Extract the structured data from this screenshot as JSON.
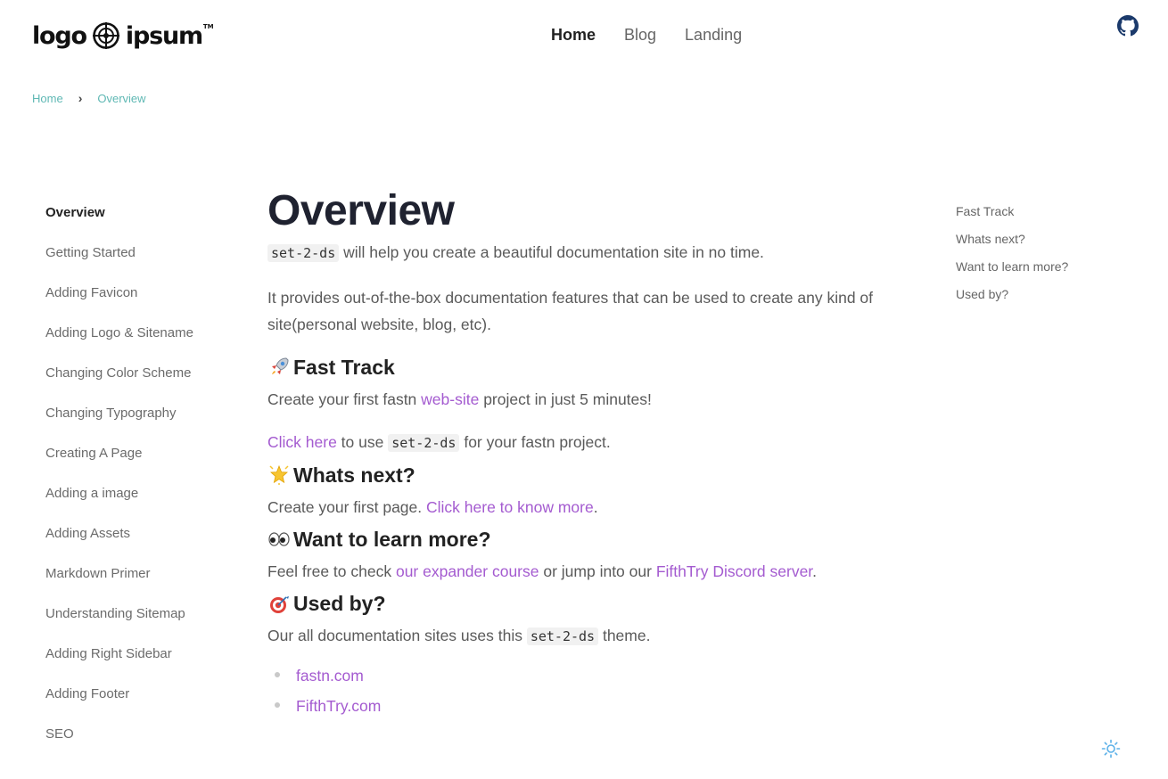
{
  "header": {
    "logo_word1": "logo",
    "logo_word2": "ipsum",
    "logo_tm": "TM",
    "nav": [
      {
        "label": "Home",
        "active": true
      },
      {
        "label": "Blog",
        "active": false
      },
      {
        "label": "Landing",
        "active": false
      }
    ],
    "github_icon": "github-icon"
  },
  "breadcrumb": {
    "home": "Home",
    "separator": "›",
    "current": "Overview"
  },
  "sidebar": {
    "items": [
      {
        "label": "Overview",
        "active": true
      },
      {
        "label": "Getting Started"
      },
      {
        "label": "Adding Favicon"
      },
      {
        "label": "Adding Logo & Sitename"
      },
      {
        "label": "Changing Color Scheme"
      },
      {
        "label": "Changing Typography"
      },
      {
        "label": "Creating A Page"
      },
      {
        "label": "Adding a image"
      },
      {
        "label": "Adding Assets"
      },
      {
        "label": "Markdown Primer"
      },
      {
        "label": "Understanding Sitemap"
      },
      {
        "label": "Adding Right Sidebar"
      },
      {
        "label": "Adding Footer"
      },
      {
        "label": "SEO"
      }
    ]
  },
  "main": {
    "title": "Overview",
    "intro_code": "set-2-ds",
    "intro_rest": " will help you create a beautiful documentation site in no time.",
    "features": "It provides out-of-the-box documentation features that can be used to create any kind of site(personal website, blog, etc).",
    "fast_track": {
      "emoji": "rocket-icon",
      "heading": "Fast Track",
      "line1_pre": "Create your first fastn ",
      "line1_link": "web-site",
      "line1_post": " project in just 5 minutes!",
      "line2_link": "Click here",
      "line2_mid": " to use ",
      "line2_code": "set-2-ds",
      "line2_post": " for your fastn project."
    },
    "whats_next": {
      "emoji": "sparkle-star-icon",
      "heading": "Whats next?",
      "pre": "Create your first page. ",
      "link": "Click here to know more",
      "post": "."
    },
    "learn_more": {
      "emoji": "eyes-icon",
      "heading": "Want to learn more?",
      "pre": "Feel free to check ",
      "link1": "our expander course",
      "mid": " or jump into our ",
      "link2": "FifthTry Discord server",
      "post": "."
    },
    "used_by": {
      "emoji": "target-dart-icon",
      "heading": "Used by?",
      "pre": "Our all documentation sites uses this ",
      "code": "set-2-ds",
      "post": " theme.",
      "sites": [
        "fastn.com",
        "FifthTry.com"
      ]
    }
  },
  "toc": {
    "items": [
      "Fast Track",
      "Whats next?",
      "Want to learn more?",
      "Used by?"
    ]
  },
  "theme_toggle_icon": "sun-icon",
  "colors": {
    "link": "#a45bd0",
    "breadcrumb": "#5fb8b4",
    "heading": "#1f2230",
    "toggle": "#5ab0e8"
  }
}
